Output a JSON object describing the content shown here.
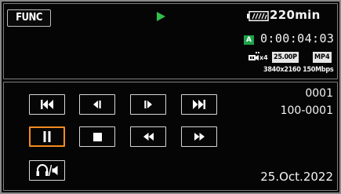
{
  "header": {
    "func_label": "FUNC",
    "battery_time": "220min"
  },
  "recording": {
    "mode_badge": "A",
    "timecode": "0:00:04:03",
    "slowmo_label": "x4",
    "frame_rate": "25.00P",
    "file_format": "MP4",
    "resolution_bitrate": "3840x2160 150Mbps"
  },
  "clip": {
    "clip_number": "0001",
    "folder_number": "100-0001",
    "date": "25.Oct.2022"
  },
  "colors": {
    "accent_orange": "#f28c1e",
    "status_green": "#2fbf4a",
    "badge_green": "#1ea34a",
    "border_gray": "#7f7f7f"
  },
  "icons": {
    "play_status": "play-icon",
    "battery": "battery-icon",
    "slowmo": "slow-motion-icon",
    "skip_back": "skip-to-start-icon",
    "frame_back": "frame-reverse-icon",
    "frame_forward": "frame-advance-icon",
    "skip_forward": "skip-to-end-icon",
    "pause": "pause-icon",
    "stop": "stop-icon",
    "rewind": "fast-reverse-icon",
    "fast_forward": "fast-forward-icon",
    "audio_volume": "headphones-speaker-icon"
  }
}
